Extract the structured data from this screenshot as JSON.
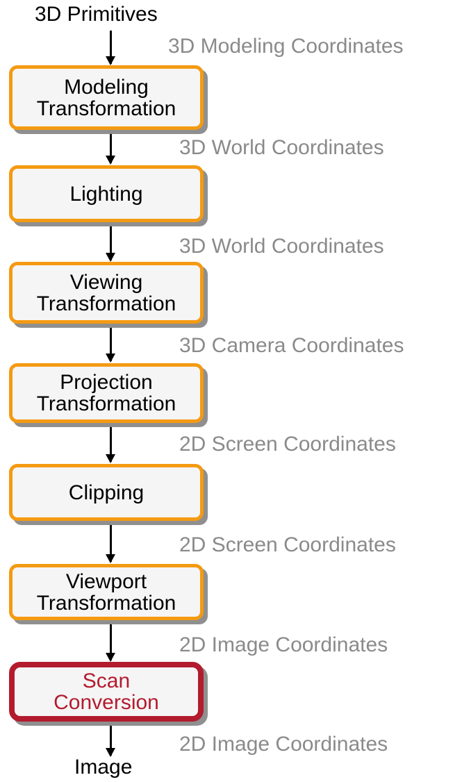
{
  "pipeline": {
    "input": "3D Primitives",
    "output": "Image",
    "stages": [
      {
        "lines": [
          "Modeling",
          "Transformation"
        ]
      },
      {
        "lines": [
          "Lighting"
        ]
      },
      {
        "lines": [
          "Viewing",
          "Transformation"
        ]
      },
      {
        "lines": [
          "Projection",
          "Transformation"
        ]
      },
      {
        "lines": [
          "Clipping"
        ]
      },
      {
        "lines": [
          "Viewport",
          "Transformation"
        ]
      },
      {
        "lines": [
          "Scan",
          "Conversion"
        ],
        "highlighted": true
      }
    ],
    "coordinate_labels": [
      "3D Modeling Coordinates",
      "3D World Coordinates",
      "3D World Coordinates",
      "3D Camera Coordinates",
      "2D Screen Coordinates",
      "2D Screen Coordinates",
      "2D Image Coordinates",
      "2D Image Coordinates"
    ]
  },
  "colors": {
    "stage_border": "#f49a12",
    "highlight_border": "#b31b2e",
    "highlight_text": "#b31b2e",
    "coordinate_text": "#8a8a8a",
    "box_fill": "#f5f5f5",
    "shadow": "#8f8f8f"
  }
}
